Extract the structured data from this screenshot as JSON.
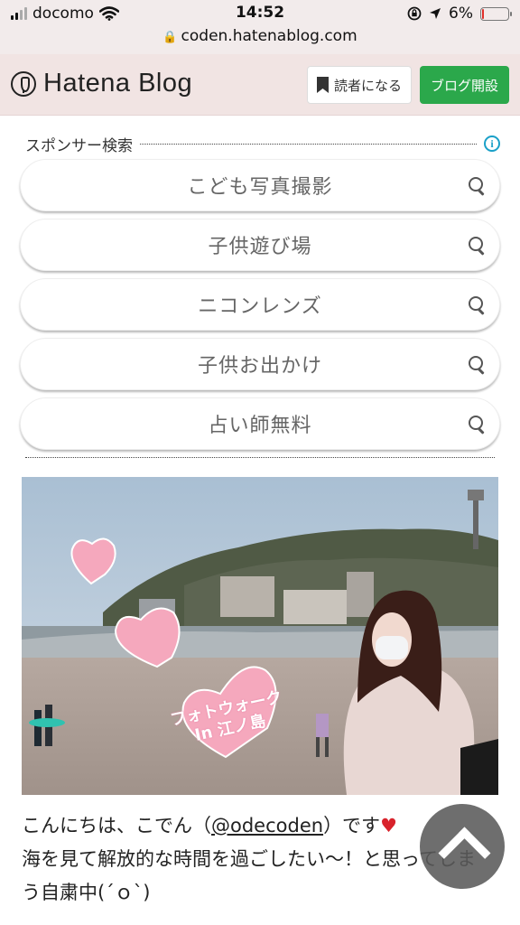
{
  "status_bar": {
    "carrier": "docomo",
    "time": "14:52",
    "battery": "6%",
    "battery_level": 0.06,
    "battery_color": "#e0302b"
  },
  "browser": {
    "url": "coden.hatenablog.com"
  },
  "header": {
    "logo_text": "Hatena Blog",
    "reader_button": "読者になる",
    "open_blog_button": "ブログ開設",
    "open_blog_color": "#2ba84b"
  },
  "sponsor": {
    "title": "スポンサー検索",
    "items": [
      {
        "label": "こども写真撮影"
      },
      {
        "label": "子供遊び場"
      },
      {
        "label": "ニコンレンズ"
      },
      {
        "label": "子供お出かけ"
      },
      {
        "label": "占い師無料"
      }
    ]
  },
  "photo": {
    "caption_line1": "フォトウォーク",
    "caption_line2": "In 江ノ島"
  },
  "article": {
    "line1_prefix": "こんにちは、こでん（",
    "mention": "@odecoden",
    "line1_suffix": "）です",
    "heart": "♥",
    "line2": "海を見て解放的な時間を過ごしたい〜！と思ってしま",
    "line3": "う自粛中(´ｏ`)"
  },
  "icons": {
    "scroll_top": "chevron-up-icon"
  }
}
